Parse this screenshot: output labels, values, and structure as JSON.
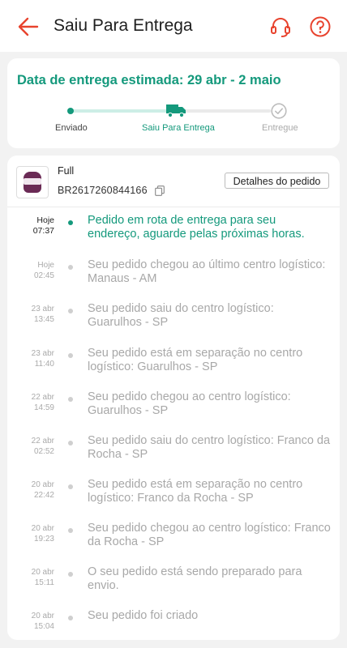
{
  "header": {
    "title": "Saiu Para Entrega",
    "back_icon": "arrow-left-icon",
    "support_icon": "headset-icon",
    "help_icon": "question-circle-icon",
    "accent_color": "#e8432e"
  },
  "delivery": {
    "estimate": "Data de entrega estimada: 29 abr - 2 maio",
    "steps": [
      {
        "label": "Enviado",
        "state": "done"
      },
      {
        "label": "Saiu Para Entrega",
        "state": "current"
      },
      {
        "label": "Entregue",
        "state": "pending"
      }
    ],
    "accent_color": "#14997c"
  },
  "order": {
    "shipping_type": "Full",
    "code": "BR2617260844166",
    "details_button": "Detalhes do pedido"
  },
  "events": [
    {
      "date": "Hoje",
      "time": "07:37",
      "text": "Pedido em rota de entrega para seu endereço, aguarde pelas próximas horas.",
      "active": true
    },
    {
      "date": "Hoje",
      "time": "02:45",
      "text": "Seu pedido chegou ao último centro logístico: Manaus - AM"
    },
    {
      "date": "23 abr",
      "time": "13:45",
      "text": "Seu pedido saiu do centro logístico: Guarulhos - SP"
    },
    {
      "date": "23 abr",
      "time": "11:40",
      "text": "Seu pedido está em separação no centro logístico: Guarulhos - SP"
    },
    {
      "date": "22 abr",
      "time": "14:59",
      "text": "Seu pedido chegou ao centro logístico: Guarulhos - SP"
    },
    {
      "date": "22 abr",
      "time": "02:52",
      "text": "Seu pedido saiu do centro logístico: Franco da Rocha - SP"
    },
    {
      "date": "20 abr",
      "time": "22:42",
      "text": "Seu pedido está em separação no centro logístico: Franco da Rocha - SP"
    },
    {
      "date": "20 abr",
      "time": "19:23",
      "text": "Seu pedido chegou ao centro logístico: Franco da Rocha - SP"
    },
    {
      "date": "20 abr",
      "time": "15:11",
      "text": "O seu pedido está sendo preparado para envio."
    },
    {
      "date": "20 abr",
      "time": "15:04",
      "text": "Seu pedido foi criado"
    }
  ]
}
